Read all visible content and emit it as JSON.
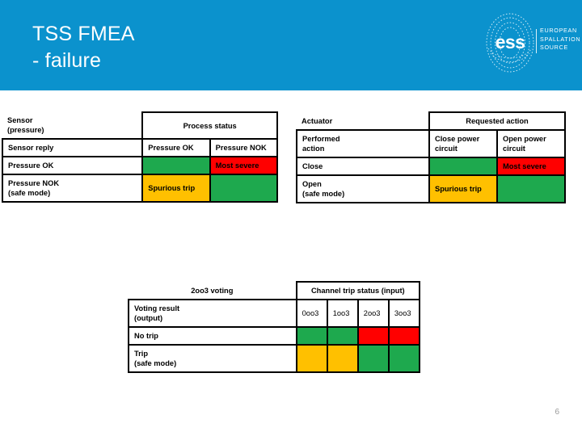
{
  "header": {
    "title": "TSS FMEA\n- failure",
    "background_color": "#0b92cd",
    "logo": {
      "wordmark": "ess",
      "name": "EUROPEAN\nSPALLATION\nSOURCE"
    }
  },
  "colors": {
    "green": "#1ea94e",
    "red": "#ff0000",
    "amber": "#ffc000",
    "banner_blue": "#0b92cd",
    "page_number_gray": "#9a9a9a"
  },
  "tables": {
    "sensor": {
      "corner_label": "Sensor\n(pressure)",
      "group_header": "Process status",
      "row_header_label": "Sensor reply",
      "column_headers": [
        "Pressure OK",
        "Pressure NOK"
      ],
      "rows": [
        {
          "label": "Pressure OK",
          "cells": [
            {
              "text": "",
              "state": "green"
            },
            {
              "text": "Most severe",
              "state": "red"
            }
          ]
        },
        {
          "label": "Pressure NOK\n(safe mode)",
          "cells": [
            {
              "text": "Spurious trip",
              "state": "amber"
            },
            {
              "text": "",
              "state": "green"
            }
          ]
        }
      ]
    },
    "actuator": {
      "corner_label": "Actuator",
      "group_header": "Requested action",
      "row_header_label": "Performed\naction",
      "column_headers": [
        "Close power\ncircuit",
        "Open power\ncircuit"
      ],
      "rows": [
        {
          "label": "Close",
          "cells": [
            {
              "text": "",
              "state": "green"
            },
            {
              "text": "Most severe",
              "state": "red"
            }
          ]
        },
        {
          "label": "Open\n(safe mode)",
          "cells": [
            {
              "text": "Spurious trip",
              "state": "amber"
            },
            {
              "text": "",
              "state": "green"
            }
          ]
        }
      ]
    },
    "voting": {
      "corner_label": "2oo3 voting",
      "group_header": "Channel trip status (input)",
      "row_header_label": "Voting result\n(output)",
      "column_headers": [
        "0oo3",
        "1oo3",
        "2oo3",
        "3oo3"
      ],
      "rows": [
        {
          "label": "No trip",
          "cells": [
            {
              "text": "",
              "state": "green"
            },
            {
              "text": "",
              "state": "green"
            },
            {
              "text": "",
              "state": "red"
            },
            {
              "text": "",
              "state": "red"
            }
          ]
        },
        {
          "label": "Trip\n(safe mode)",
          "cells": [
            {
              "text": "",
              "state": "amber"
            },
            {
              "text": "",
              "state": "amber"
            },
            {
              "text": "",
              "state": "green"
            },
            {
              "text": "",
              "state": "green"
            }
          ]
        }
      ]
    }
  },
  "footer": {
    "page_number": "6"
  }
}
